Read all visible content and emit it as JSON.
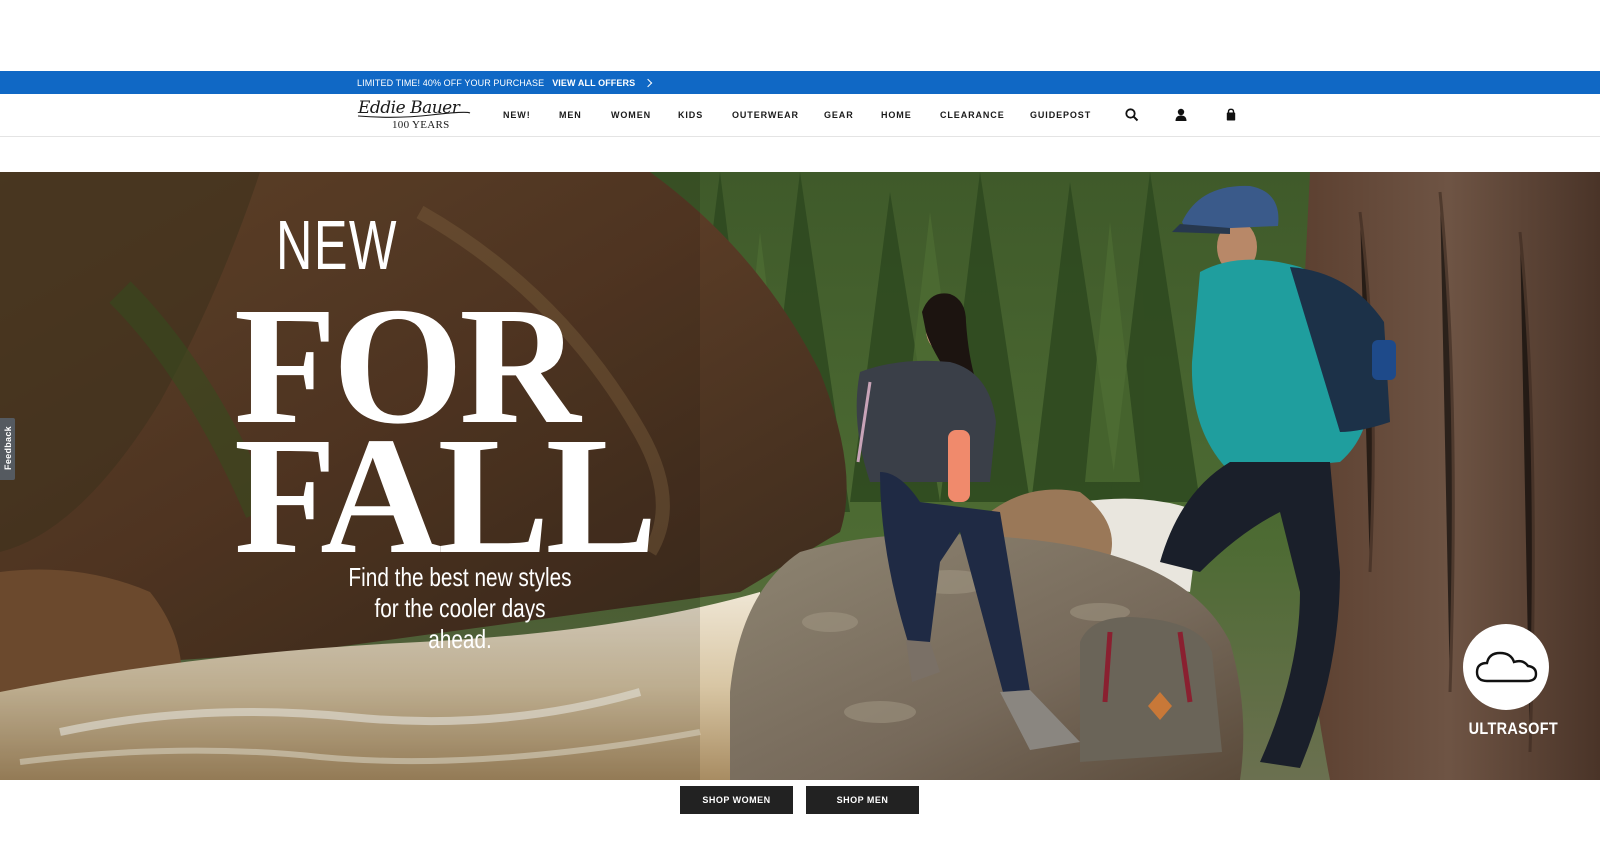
{
  "promo": {
    "text": "LIMITED TIME! 40% OFF YOUR PURCHASE",
    "link_label": "VIEW ALL OFFERS"
  },
  "header": {
    "logo_script": "Eddie Bauer",
    "logo_years": "100 YEARS",
    "nav": [
      "NEW!",
      "MEN",
      "WOMEN",
      "KIDS",
      "OUTERWEAR",
      "GEAR",
      "HOME",
      "CLEARANCE",
      "GUIDEPOST"
    ],
    "icons": [
      "search-icon",
      "account-icon",
      "shopping-bag-icon"
    ]
  },
  "hero": {
    "line1": "NEW",
    "line2": "FOR",
    "line3": "FALL",
    "subtitle_line1": "Find the best new styles",
    "subtitle_line2": "for the cooler days ahead.",
    "badge_icon": "cloud-icon",
    "badge_label": "ULTRASOFT"
  },
  "feedback_label": "Feedback",
  "cta": {
    "women": "SHOP WOMEN",
    "men": "SHOP MEN"
  },
  "colors": {
    "promo_bar": "#1068c5",
    "button": "#222222"
  }
}
